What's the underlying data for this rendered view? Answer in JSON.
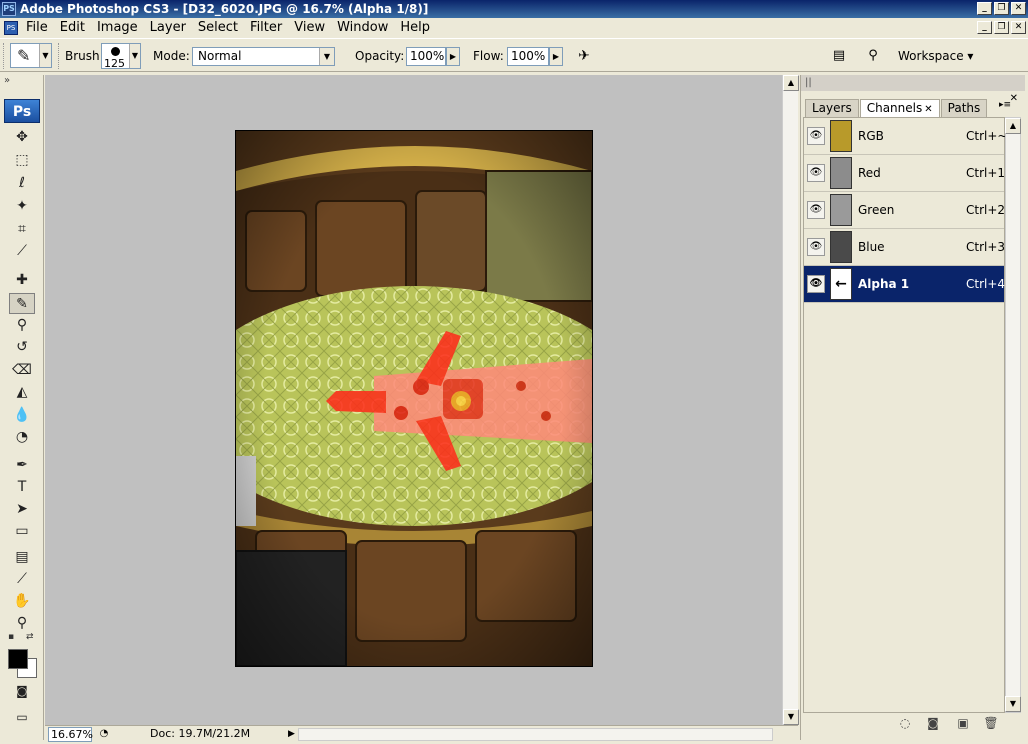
{
  "window": {
    "app_icon": "PS",
    "title": "Adobe Photoshop CS3 - [D32_6020.JPG @ 16.7% (Alpha 1/8)]",
    "controls": [
      "_",
      "❐",
      "✕"
    ]
  },
  "menubar": {
    "items": [
      "File",
      "Edit",
      "Image",
      "Layer",
      "Select",
      "Filter",
      "View",
      "Window",
      "Help"
    ]
  },
  "options": {
    "brush_label": "Brush:",
    "brush_size": "125",
    "mode_label": "Mode:",
    "mode_value": "Normal",
    "opacity_label": "Opacity:",
    "opacity_value": "100%",
    "flow_label": "Flow:",
    "flow_value": "100%",
    "workspace_label": "Workspace ▾"
  },
  "toolbox": {
    "logo": "Ps",
    "tools": [
      {
        "name": "move-tool-icon",
        "glyph": "✥"
      },
      {
        "name": "marquee-tool-icon",
        "glyph": "⬚"
      },
      {
        "name": "lasso-tool-icon",
        "glyph": "ℓ"
      },
      {
        "name": "magic-wand-tool-icon",
        "glyph": "✦"
      },
      {
        "name": "crop-tool-icon",
        "glyph": "⌗"
      },
      {
        "name": "slice-tool-icon",
        "glyph": "⟋"
      },
      {
        "name": "healing-brush-tool-icon",
        "glyph": "✚"
      },
      {
        "name": "brush-tool-icon",
        "glyph": "✎"
      },
      {
        "name": "clone-stamp-tool-icon",
        "glyph": "⚲"
      },
      {
        "name": "history-brush-tool-icon",
        "glyph": "↺"
      },
      {
        "name": "eraser-tool-icon",
        "glyph": "⌫"
      },
      {
        "name": "paint-bucket-tool-icon",
        "glyph": "◭"
      },
      {
        "name": "blur-tool-icon",
        "glyph": "💧"
      },
      {
        "name": "dodge-tool-icon",
        "glyph": "◔"
      },
      {
        "name": "pen-tool-icon",
        "glyph": "✒"
      },
      {
        "name": "type-tool-icon",
        "glyph": "T"
      },
      {
        "name": "path-selection-tool-icon",
        "glyph": "➤"
      },
      {
        "name": "shape-tool-icon",
        "glyph": "▭"
      },
      {
        "name": "notes-tool-icon",
        "glyph": "▤"
      },
      {
        "name": "eyedropper-tool-icon",
        "glyph": "⟋"
      },
      {
        "name": "hand-tool-icon",
        "glyph": "✋"
      },
      {
        "name": "zoom-tool-icon",
        "glyph": "⚲"
      }
    ]
  },
  "status": {
    "zoom": "16.67%",
    "doc_info": "Doc: 19.7M/21.2M"
  },
  "panel": {
    "tabs": [
      {
        "label": "Layers",
        "active": false
      },
      {
        "label": "Channels",
        "active": true
      },
      {
        "label": "Paths",
        "active": false
      }
    ],
    "channels": [
      {
        "name": "RGB",
        "shortcut": "Ctrl+~",
        "selected": false,
        "thumb": "#b89a2a"
      },
      {
        "name": "Red",
        "shortcut": "Ctrl+1",
        "selected": false,
        "thumb": "#8c8c8c"
      },
      {
        "name": "Green",
        "shortcut": "Ctrl+2",
        "selected": false,
        "thumb": "#9a9a9a"
      },
      {
        "name": "Blue",
        "shortcut": "Ctrl+3",
        "selected": false,
        "thumb": "#4a4a4a"
      },
      {
        "name": "Alpha 1",
        "shortcut": "Ctrl+4",
        "selected": true,
        "thumb": "#ffffff"
      }
    ]
  },
  "colors": {
    "selection_blue": "#0a246a",
    "workspace_gray": "#c0c0c0",
    "quick_mask_red": "#ff2a1a"
  }
}
